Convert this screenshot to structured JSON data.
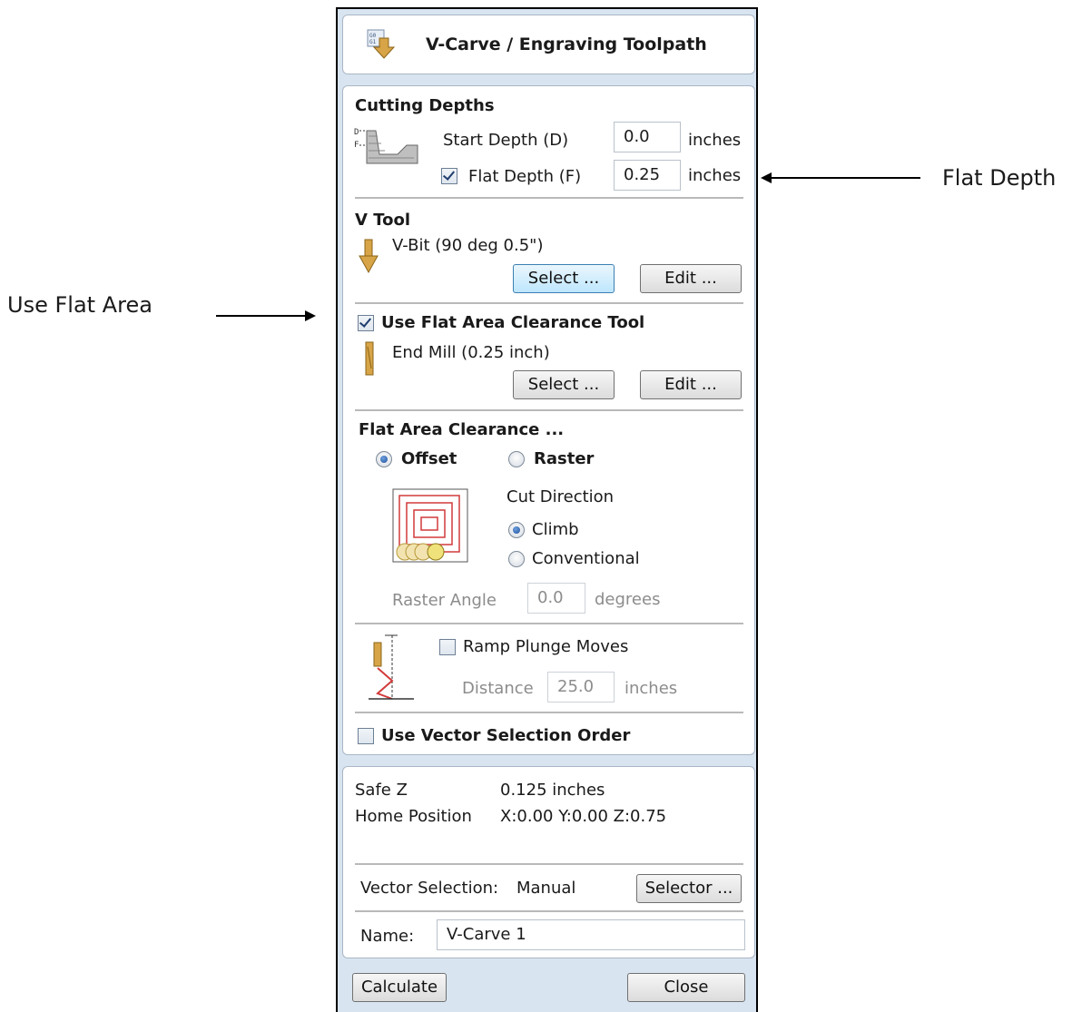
{
  "annotations": {
    "left_label": "Use Flat Area",
    "right_label": "Flat Depth"
  },
  "header": {
    "title": "V-Carve / Engraving Toolpath",
    "icon": "toolpath-icon"
  },
  "cutting_depths": {
    "heading": "Cutting Depths",
    "start_depth": {
      "label": "Start Depth (D)",
      "value": "0.0",
      "unit": "inches"
    },
    "flat_depth": {
      "label": "Flat Depth (F)",
      "checked": true,
      "value": "0.25",
      "unit": "inches"
    }
  },
  "v_tool": {
    "heading": "V Tool",
    "tool_name": "V-Bit (90 deg 0.5\")",
    "select_label": "Select ...",
    "edit_label": "Edit ..."
  },
  "flat_area_tool": {
    "checkbox_label": "Use Flat Area Clearance Tool",
    "checked": true,
    "tool_name": "End Mill (0.25 inch)",
    "select_label": "Select ...",
    "edit_label": "Edit ..."
  },
  "flat_area_clearance": {
    "heading": "Flat Area Clearance ...",
    "offset_label": "Offset",
    "raster_label": "Raster",
    "selected": "Offset",
    "cut_direction_label": "Cut Direction",
    "climb_label": "Climb",
    "conventional_label": "Conventional",
    "cut_direction_selected": "Climb",
    "raster_angle": {
      "label": "Raster Angle",
      "value": "0.0",
      "unit": "degrees"
    }
  },
  "ramp": {
    "checkbox_label": "Ramp Plunge Moves",
    "checked": false,
    "distance": {
      "label": "Distance",
      "value": "25.0",
      "unit": "inches"
    }
  },
  "vector_order": {
    "label": "Use Vector Selection Order",
    "checked": false
  },
  "summary": {
    "safe_z_label": "Safe Z",
    "safe_z_value": "0.125 inches",
    "home_label": "Home Position",
    "home_value": "X:0.00 Y:0.00 Z:0.75",
    "vector_selection_label": "Vector Selection:",
    "vector_selection_value": "Manual",
    "selector_label": "Selector ...",
    "name_label": "Name:",
    "name_value": "V-Carve 1"
  },
  "footer": {
    "calculate_label": "Calculate",
    "close_label": "Close"
  }
}
